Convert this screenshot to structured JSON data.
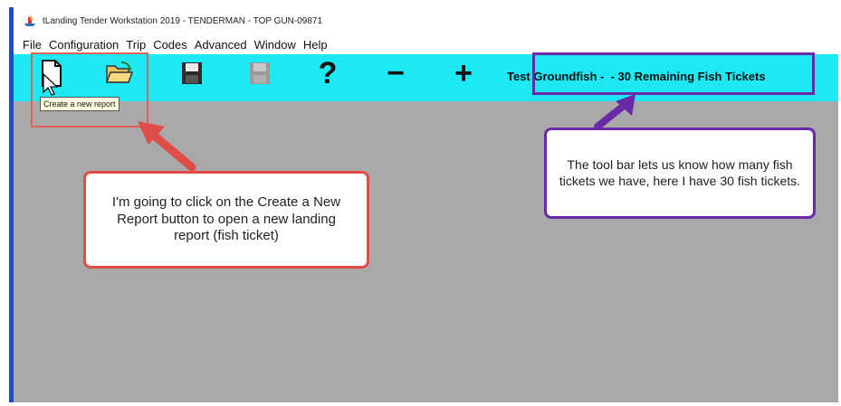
{
  "window": {
    "title": "tLanding Tender Workstation 2019 - TENDERMAN - TOP GUN-09871"
  },
  "menu": {
    "items": [
      "File",
      "Configuration",
      "Trip",
      "Codes",
      "Advanced",
      "Window",
      "Help"
    ]
  },
  "toolbar": {
    "background": "#1fe8f5",
    "buttons": [
      {
        "name": "new-report",
        "icon": "new-document-icon"
      },
      {
        "name": "open",
        "icon": "open-folder-icon"
      },
      {
        "name": "save",
        "icon": "save-disk-icon"
      },
      {
        "name": "save-disabled",
        "icon": "save-disk-disabled-icon"
      },
      {
        "name": "help",
        "icon": "question-icon",
        "glyph": "?"
      },
      {
        "name": "remove",
        "icon": "minus-icon",
        "glyph": "−"
      },
      {
        "name": "add",
        "icon": "plus-icon",
        "glyph": "+"
      }
    ],
    "status": "Test Groundfish -  - 30 Remaining Fish Tickets"
  },
  "tooltip": {
    "text": "Create a new report"
  },
  "annotations": {
    "red_callout": "I'm going to click on the Create a New Report button to open a new landing report (fish ticket)",
    "purple_callout": "The tool bar lets us know how many fish tickets we have, here I have 30 fish tickets.",
    "red_color": "#e04d48",
    "purple_color": "#6a2aa8"
  }
}
